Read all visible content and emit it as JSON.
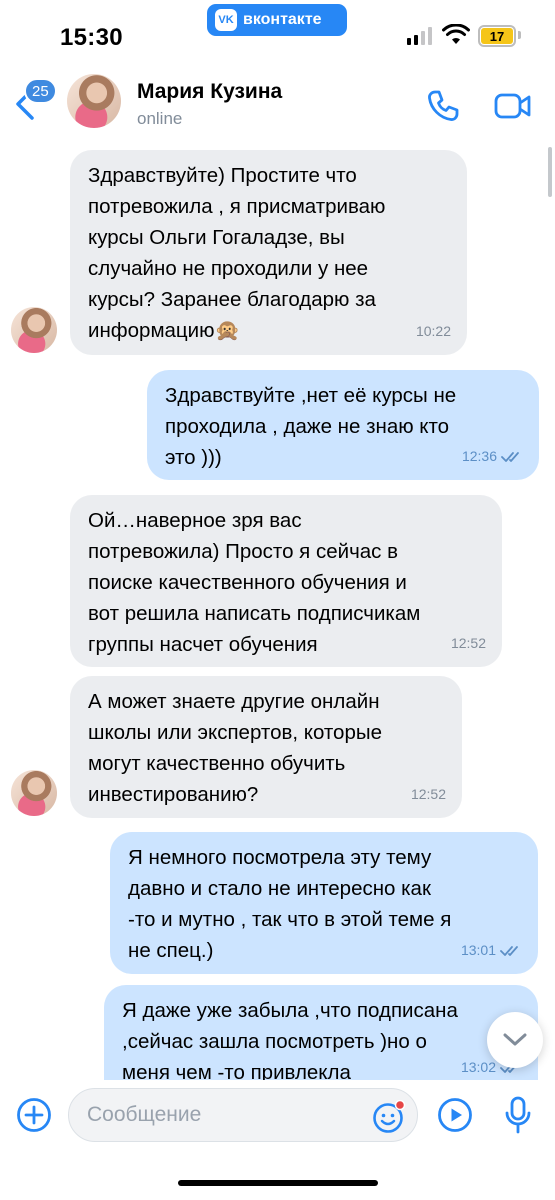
{
  "status_bar": {
    "time": "15:30",
    "app_pill": "вконтакте",
    "app_logo": "VK",
    "battery": "17"
  },
  "header": {
    "unread_count": "25",
    "name": "Мария Кузина",
    "status": "online"
  },
  "messages": [
    {
      "direction": "in",
      "text": "Здравствуйте) Простите что\nпотревожила , я присматриваю\nкурсы Ольги Гогаладзе, вы\nслучайно не проходили у нее\nкурсы? Заранее благодарю за\nинформацию🙊",
      "time": "10:22"
    },
    {
      "direction": "out",
      "text": "Здравствуйте ,нет её курсы не\nпроходила , даже не знаю кто\nэто )))",
      "time": "12:36"
    },
    {
      "direction": "in",
      "text": "Ой…наверное зря вас\nпотревожила) Просто я сейчас в\nпоиске качественного обучения и\nвот решила написать подписчикам\nгруппы насчет обучения",
      "time": "12:52"
    },
    {
      "direction": "in",
      "text": "А может знаете другие онлайн\nшколы или экспертов, которые\nмогут качественно обучить\nинвестированию?",
      "time": "12:52"
    },
    {
      "direction": "out",
      "text": "Я немного посмотрела эту тему\nдавно и стало не интересно как\n-то и мутно , так что в этой теме я\nне спец.)",
      "time": "13:01"
    },
    {
      "direction": "out",
      "text": "Я даже уже забыла ,что подписана\n,сейчас зашла посмотреть )но о\nменя чем -то привлекла",
      "time": "13:02"
    }
  ],
  "composer": {
    "placeholder": "Сообщение"
  },
  "colors": {
    "accent": "#2787f5",
    "incoming_bubble": "#ebedf0",
    "outgoing_bubble": "#cce4ff",
    "secondary_text": "#818c99"
  },
  "icons": [
    "back-chevron-icon",
    "phone-icon",
    "video-call-icon",
    "double-check-icon",
    "chevron-down-icon",
    "plus-icon",
    "emoji-icon",
    "video-message-icon",
    "microphone-icon"
  ]
}
